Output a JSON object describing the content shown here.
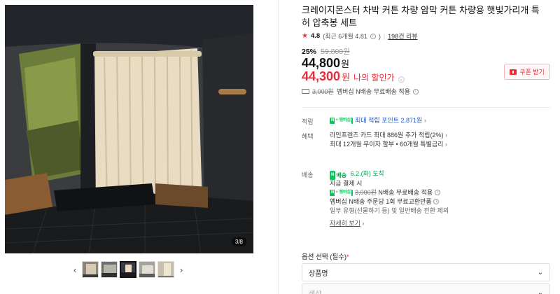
{
  "gallery": {
    "counter": "3/8",
    "prev_icon": "‹",
    "next_icon": "›",
    "thumbnail_count": 5,
    "active_thumbnail": 3
  },
  "product": {
    "title": "크레이지몬스터 차박 커튼 차량 암막 커튼 차량용 햇빛가리개 특허 압축봉 세트",
    "rating_score": "4.8",
    "rating_detail": "(최근 6개월 4.81",
    "rating_detail_close": ")",
    "review_link": "198건 리뷰",
    "discount_percent": "25%",
    "original_price": "59,800원",
    "price": "44,800",
    "price_unit": "원",
    "my_discount_price": "44,300",
    "my_discount_unit": "원",
    "my_discount_label": "나의 할인가",
    "coupon_button": "쿠폰 받기",
    "shipping_summary_strike": "3,000원",
    "shipping_summary_text": "멤버십 N배송 무료배송 적용"
  },
  "points": {
    "label": "적립",
    "badge": "N",
    "badge_plus": "+ 멤버십",
    "text": "최대 적립 포인트 2,871원"
  },
  "benefits": {
    "label": "혜택",
    "line1": "라인프렌즈 카드 최대 886원 추가 적립(2%)",
    "line2": "최대 12개월 무이자 할부 • 60개월 특별금리"
  },
  "delivery": {
    "label": "배송",
    "badge_n": "N",
    "badge_text": "배송",
    "arrival": "6.2.(화) 도착",
    "pay_today": "지금 결제 시",
    "badge": "N",
    "badge_plus": "+ 멤버십",
    "fee_strike": "3,000원",
    "fee_text": "N배송 무료배송 적용",
    "exchange": "멤버십 N배송 주문당 1회 무료교환반품",
    "exclusion": "일부 유형(선물하기 등) 및 일반배송 전환 제외",
    "more_link": "자세히 보기"
  },
  "options": {
    "label": "옵션 선택 (필수)",
    "required": "*",
    "select1": "상품명",
    "select2": "색상"
  },
  "colors": {
    "accent_red": "#ec2b3a",
    "npay_green": "#03c75a",
    "link_blue": "#1d58d1"
  }
}
